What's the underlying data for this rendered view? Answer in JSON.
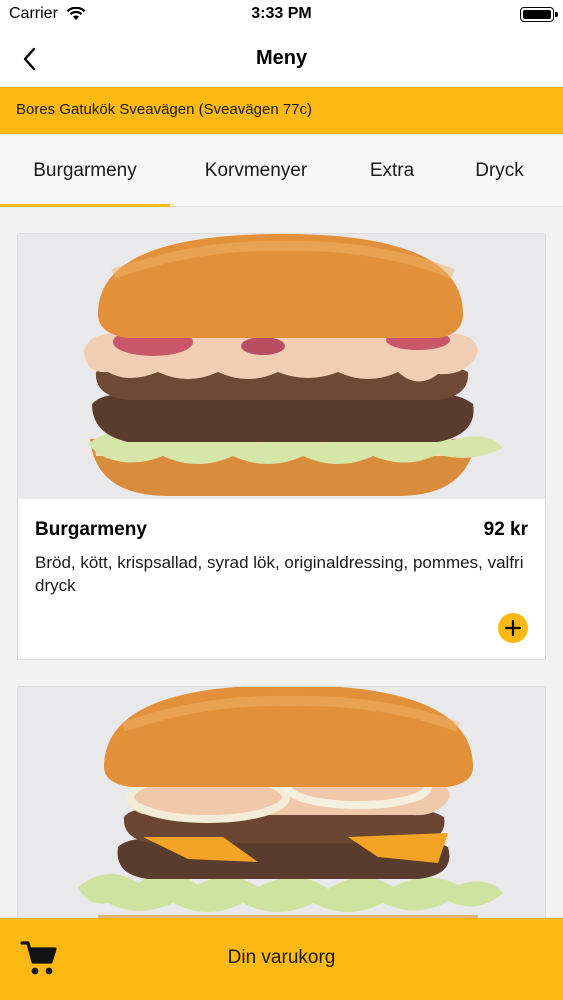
{
  "status_bar": {
    "carrier": "Carrier",
    "time": "3:33 PM"
  },
  "nav": {
    "title": "Meny",
    "back_icon": "chevron-left-icon"
  },
  "store": {
    "name": "Bores Gatukök Sveavägen (Sveavägen 77c)"
  },
  "tabs": [
    {
      "label": "Burgarmeny",
      "selected": true
    },
    {
      "label": "Korvmenyer",
      "selected": false
    },
    {
      "label": "Extra",
      "selected": false
    },
    {
      "label": "Dryck",
      "selected": false
    }
  ],
  "menu_items": [
    {
      "title": "Burgarmeny",
      "price": "92 kr",
      "description": "Bröd, kött, krispsallad, syrad lök, originaldressing, pommes, valfri dryck"
    }
  ],
  "cart": {
    "label": "Din varukorg",
    "icon": "cart-icon"
  },
  "colors": {
    "accent": "#fcb813"
  }
}
